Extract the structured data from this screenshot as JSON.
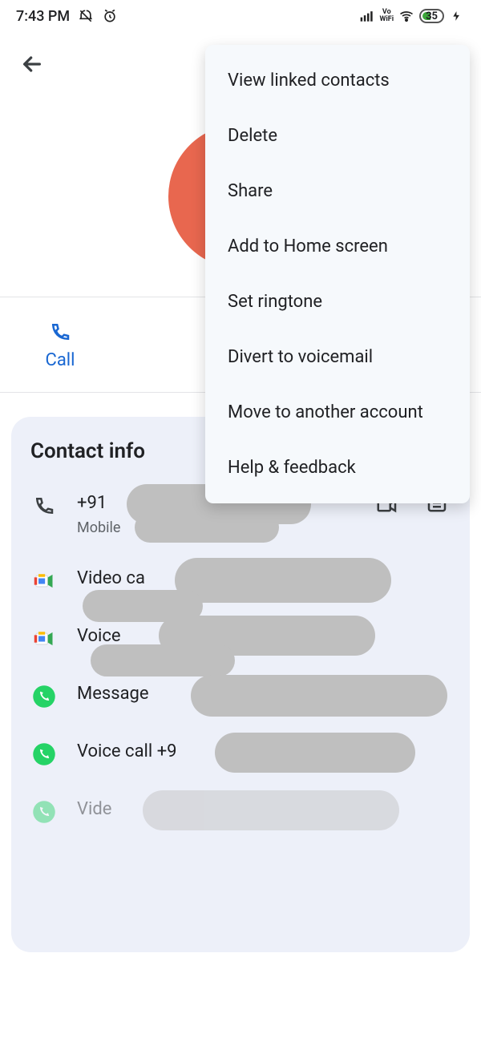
{
  "status": {
    "time": "7:43 PM",
    "battery_text": "35"
  },
  "actions": {
    "call": "Call"
  },
  "menu": {
    "items": [
      "View linked contacts",
      "Delete",
      "Share",
      "Add to Home screen",
      "Set ringtone",
      "Divert to voicemail",
      "Move to another account",
      "Help & feedback"
    ]
  },
  "card": {
    "title": "Contact info",
    "rows": {
      "phone": {
        "primary": "+91",
        "secondary": "Mobile"
      },
      "meet_video": {
        "primary": "Video ca"
      },
      "meet_voice": {
        "primary": "Voice"
      },
      "wa_message": {
        "primary": "Message"
      },
      "wa_voice": {
        "primary": "Voice call +9"
      },
      "wa_video": {
        "primary": "Vide"
      }
    }
  }
}
